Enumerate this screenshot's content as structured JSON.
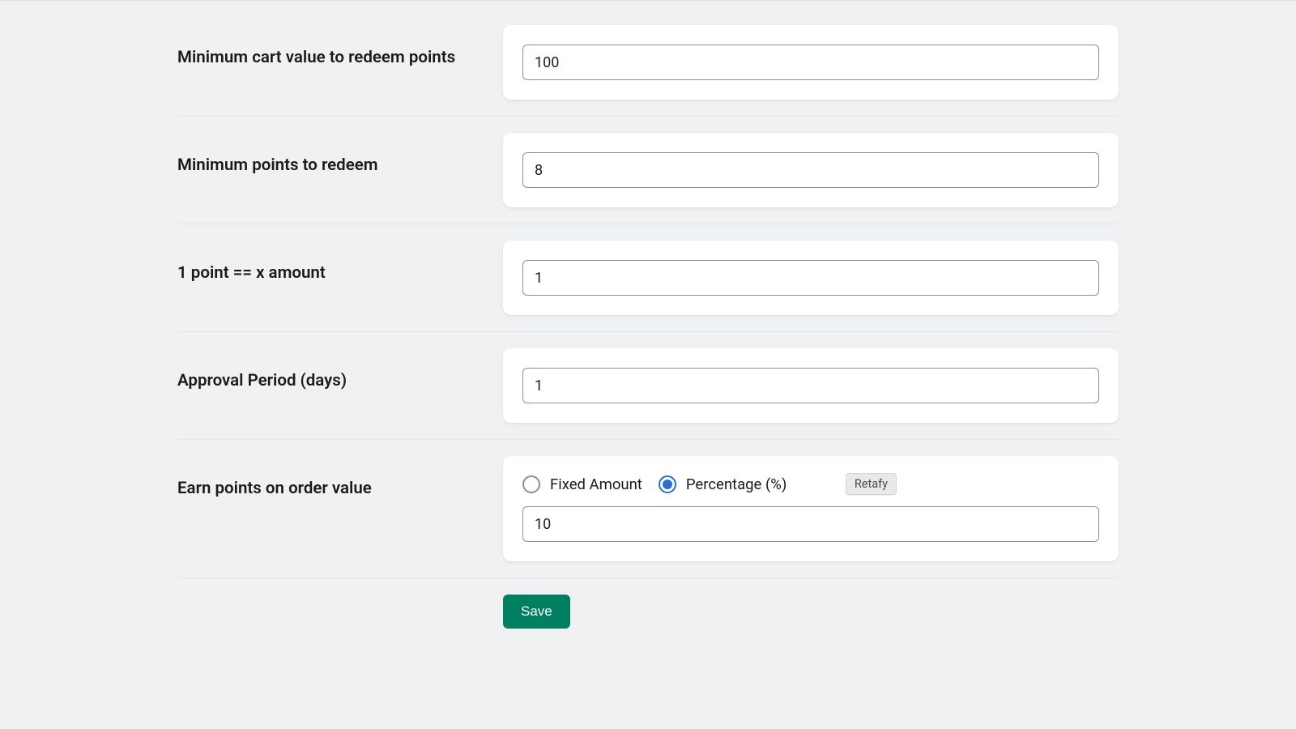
{
  "fields": {
    "minCartValue": {
      "label": "Minimum cart value to redeem points",
      "value": "100"
    },
    "minPoints": {
      "label": "Minimum points to redeem",
      "value": "8"
    },
    "pointAmount": {
      "label": "1 point == x amount",
      "value": "1"
    },
    "approval": {
      "label": "Approval Period (days)",
      "value": "1"
    },
    "earn": {
      "label": "Earn points on order value",
      "options": {
        "fixed": "Fixed Amount",
        "percentage": "Percentage (%)"
      },
      "selected": "percentage",
      "value": "10"
    }
  },
  "badge": "Retafy",
  "buttons": {
    "save": "Save"
  }
}
